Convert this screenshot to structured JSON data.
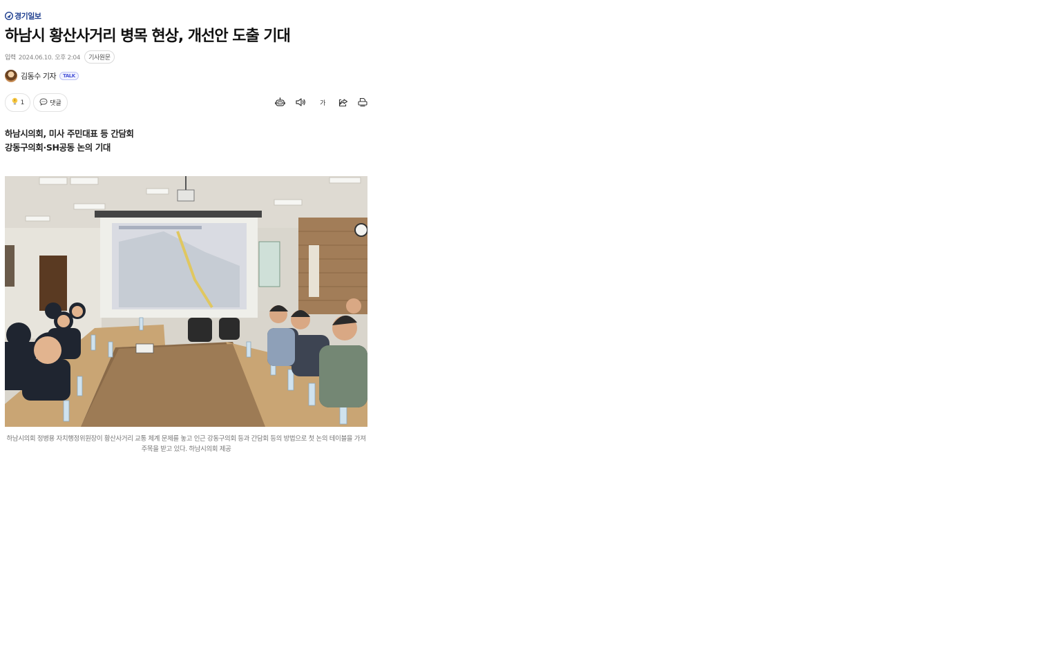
{
  "site": {
    "brand": "경기일보"
  },
  "article": {
    "title": "하남시 황산사거리 병목 현상, 개선안 도출 기대",
    "meta": {
      "input_label": "입력",
      "date": "2024.06.10. 오후 2:04",
      "original_button": "기사원문"
    },
    "author": {
      "name": "김동수 기자",
      "badge": "TALK"
    },
    "actions": {
      "like_count": "1",
      "comment_label": "댓글"
    },
    "subheadings": [
      "하남시의회, 미사 주민대표 등 간담회",
      "강동구의회·SH공동 논의 기대"
    ],
    "photo_caption": "하남시의회 정병용 자치행정위원장이 황산사거리 교통 체계 문제를 놓고 인근 강동구의회 등과 간담회 등의 방법으로 첫 논의 테이블을 가져 주목을 받고 있다. 하남시의회 제공"
  },
  "toolbar": {
    "font_size_label": "가",
    "icons": [
      "summary-robot-icon",
      "speaker-icon",
      "font-size-icon",
      "share-icon",
      "print-icon"
    ]
  },
  "colors": {
    "brand": "#1f3f8f",
    "talk_badge": "#4a56d8",
    "text": "#111111",
    "caption": "#777777"
  }
}
